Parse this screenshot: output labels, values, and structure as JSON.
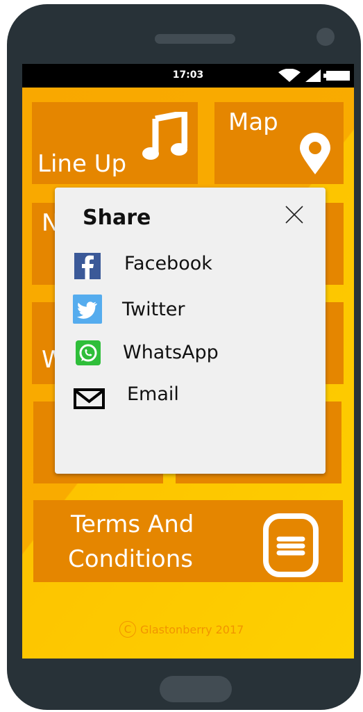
{
  "status_bar": {
    "time": "17:03"
  },
  "tiles": {
    "line_up": {
      "label": "Line Up",
      "icon": "music-note-icon"
    },
    "map": {
      "label": "Map",
      "icon": "map-pin-icon"
    },
    "news_partial": {
      "label": "N"
    },
    "w_partial": {
      "label": "W"
    },
    "terms": {
      "label_line1": "Terms And",
      "label_line2": "Conditions",
      "icon": "document-icon"
    }
  },
  "footer": {
    "copyright_symbol": "C",
    "text": "Glastonberry 2017"
  },
  "share_dialog": {
    "title": "Share",
    "options": [
      {
        "label": "Facebook",
        "icon": "facebook-icon"
      },
      {
        "label": "Twitter",
        "icon": "twitter-icon"
      },
      {
        "label": "WhatsApp",
        "icon": "whatsapp-icon"
      },
      {
        "label": "Email",
        "icon": "email-icon"
      }
    ]
  },
  "colors": {
    "screen_bg": "#f9b000",
    "tile": "#e58600",
    "phone_body": "#283238",
    "dialog_bg": "#f0f0f0",
    "facebook": "#3b5998",
    "twitter": "#55acee",
    "whatsapp": "#2fbe3a"
  }
}
